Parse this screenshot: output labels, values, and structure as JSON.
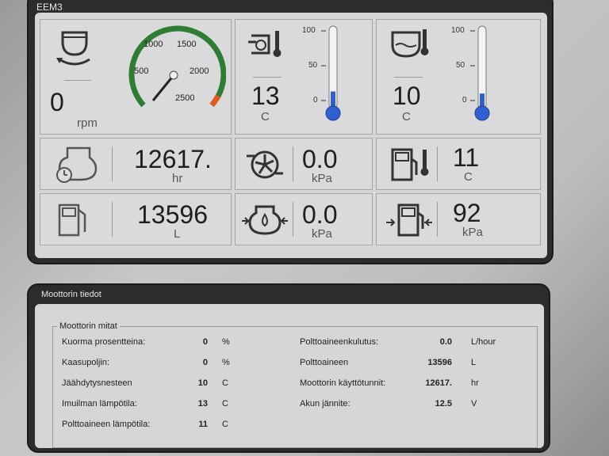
{
  "window": {
    "title": "EEM3"
  },
  "gauges": {
    "rpm": {
      "value": "0",
      "unit": "rpm",
      "scale_labels": [
        "500",
        "1000",
        "1500",
        "2000",
        "2500"
      ],
      "needle_rpm": 0
    },
    "coolant_temp": {
      "value": "13",
      "unit": "C",
      "ticks": [
        "100",
        "50",
        "0"
      ],
      "level_percent": 13
    },
    "oil_temp": {
      "value": "10",
      "unit": "C",
      "ticks": [
        "100",
        "50",
        "0"
      ],
      "level_percent": 10
    },
    "engine_hours": {
      "value": "12617.",
      "unit": "hr"
    },
    "turbo_pressure": {
      "value": "0.0",
      "unit": "kPa"
    },
    "fuel_temp": {
      "value": "11",
      "unit": "C"
    },
    "fuel_used": {
      "value": "13596",
      "unit": "L"
    },
    "oil_pressure": {
      "value": "0.0",
      "unit": "kPa"
    },
    "fuel_pressure": {
      "value": "92",
      "unit": "kPa"
    }
  },
  "details": {
    "title": "Moottorin tiedot",
    "group_title": "Moottorin mitat",
    "left_rows": [
      {
        "label": "Kuorma prosentteina:",
        "value": "0",
        "unit": "%"
      },
      {
        "label": "Kaasupoljin:",
        "value": "0",
        "unit": "%"
      },
      {
        "label": "Jäähdytysnesteen",
        "value": "10",
        "unit": "C"
      },
      {
        "label": "Imuilman lämpötila:",
        "value": "13",
        "unit": "C"
      },
      {
        "label": "Polttoaineen lämpötila:",
        "value": "11",
        "unit": "C"
      }
    ],
    "right_rows": [
      {
        "label": "Polttoaineenkulutus:",
        "value": "0.0",
        "unit": "L/hour"
      },
      {
        "label": "Polttoaineen",
        "value": "13596",
        "unit": "L"
      },
      {
        "label": "Moottorin käyttötunnit:",
        "value": "12617.",
        "unit": "hr"
      },
      {
        "label": "Akun jännite:",
        "value": "12.5",
        "unit": "V"
      }
    ]
  }
}
